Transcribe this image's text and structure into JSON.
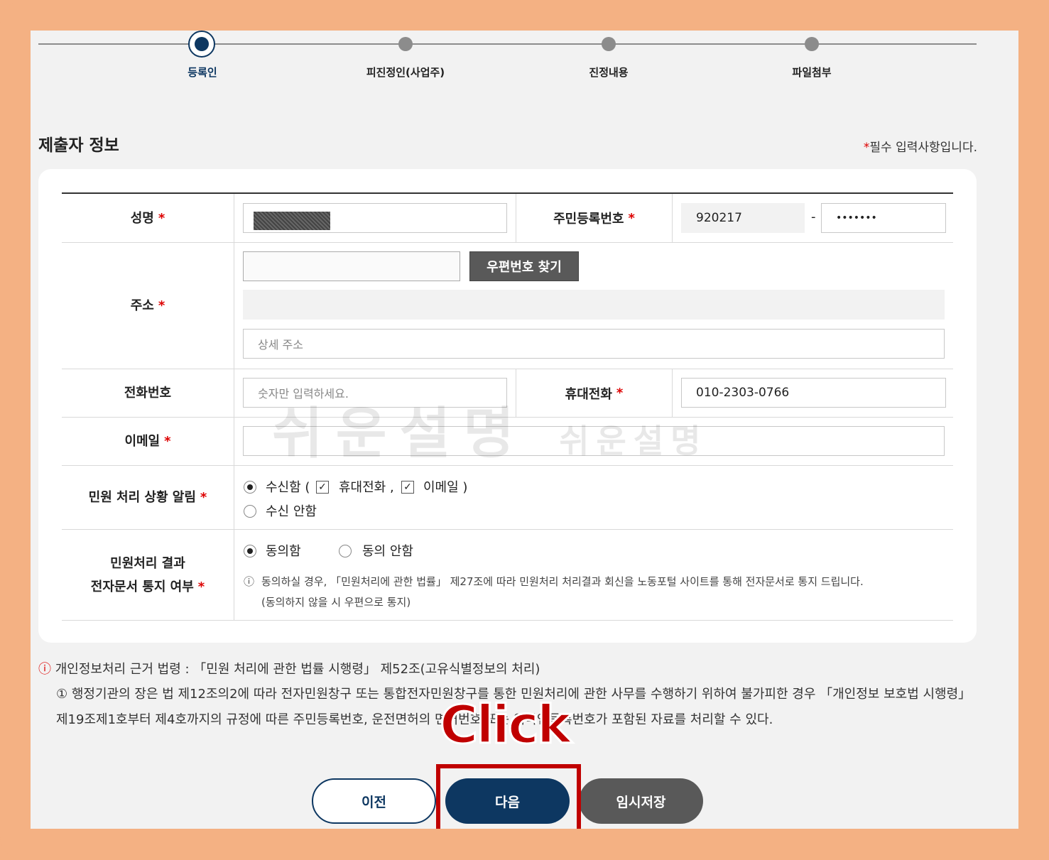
{
  "stepper": {
    "steps": [
      {
        "label": "등록인",
        "active": true
      },
      {
        "label": "피진정인(사업주)",
        "active": false
      },
      {
        "label": "진정내용",
        "active": false
      },
      {
        "label": "파일첨부",
        "active": false
      }
    ]
  },
  "section": {
    "title": "제출자 정보",
    "required_star": "*",
    "required_note": "필수 입력사항입니다."
  },
  "form": {
    "required_star": "*",
    "name": {
      "label": "성명"
    },
    "resident_no": {
      "label": "주민등록번호",
      "front": "920217",
      "separator": "-",
      "back": "•••••••"
    },
    "address": {
      "label": "주소",
      "zip_button": "우편번호 찾기",
      "detail_placeholder": "상세 주소"
    },
    "phone": {
      "label": "전화번호",
      "placeholder": "숫자만 입력하세요."
    },
    "mobile": {
      "label": "휴대전화",
      "value": "010-2303-0766"
    },
    "email": {
      "label": "이메일"
    },
    "notify": {
      "label": "민원 처리 상황 알림",
      "opt_receive": "수신함 (",
      "opt_mobile": "휴대전화 ,",
      "opt_email": "이메일 )",
      "opt_no_receive": "수신 안함",
      "receive_selected": true,
      "mobile_checked": true,
      "email_checked": true
    },
    "edoc": {
      "label_line1": "민원처리 결과",
      "label_line2": "전자문서 통지 여부",
      "opt_agree": "동의함",
      "opt_disagree": "동의 안함",
      "agree_selected": true,
      "info_icon": "ⓘ",
      "info_line1": "동의하실 경우, 「민원처리에 관한 법률」 제27조에 따라 민원처리 처리결과 회신을 노동포털 사이트를 통해 전자문서로 통지 드립니다.",
      "info_line2": "(동의하지 않을 시 우편으로 통지)"
    }
  },
  "watermark": {
    "big": "쉬운설명",
    "small": "쉬운설명"
  },
  "notice": {
    "icon": "ⓘ",
    "title": "개인정보처리 근거 법령 : 「민원 처리에 관한 법률 시행령」 제52조(고유식별정보의 처리)",
    "body": "① 행정기관의 장은 법 제12조의2에 따라 전자민원창구 또는 통합전자민원창구를 통한 민원처리에 관한 사무를 수행하기 위하여 불가피한 경우 「개인정보 보호법 시행령」 제19조제1호부터 제4호까지의 규정에 따른 주민등록번호, 운전면허의 면허번호 또는 외국인등록번호가 포함된 자료를 처리할 수 있다."
  },
  "buttons": {
    "prev": "이전",
    "next": "다음",
    "temp_save": "임시저장"
  },
  "annotation": {
    "click_text": "Click",
    "color": "#c00000"
  },
  "colors": {
    "primary": "#0d3761",
    "accent_red": "#d00000",
    "frame": "#f4b183",
    "dark_button": "#595959"
  }
}
